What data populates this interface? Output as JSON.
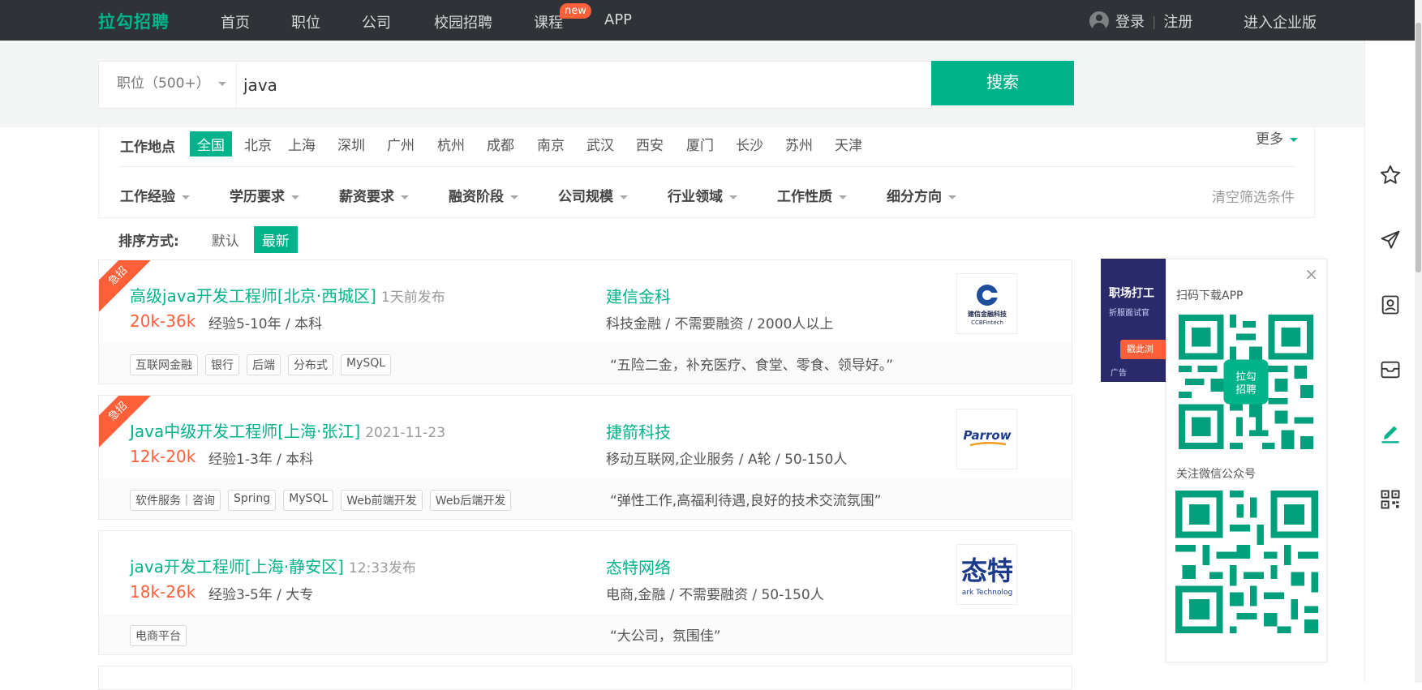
{
  "header": {
    "logo": "拉勾招聘",
    "nav": [
      "首页",
      "职位",
      "公司",
      "校园招聘",
      "课程",
      "APP"
    ],
    "new_badge": "new",
    "login": "登录",
    "register": "注册",
    "enterprise": "进入企业版"
  },
  "search": {
    "type_label": "职位（500+）",
    "query": "java",
    "button": "搜索"
  },
  "filters": {
    "location_label": "工作地点",
    "cities": [
      "全国",
      "北京",
      "上海",
      "深圳",
      "广州",
      "杭州",
      "成都",
      "南京",
      "武汉",
      "西安",
      "厦门",
      "长沙",
      "苏州",
      "天津"
    ],
    "active_city": "全国",
    "more": "更多",
    "dropdowns": [
      "工作经验",
      "学历要求",
      "薪资要求",
      "融资阶段",
      "公司规模",
      "行业领域",
      "工作性质",
      "细分方向"
    ],
    "clear": "清空筛选条件"
  },
  "sort": {
    "label": "排序方式:",
    "options": [
      "默认",
      "最新"
    ],
    "active": "最新"
  },
  "jobs": [
    {
      "urgent": "急招",
      "title": "高级java开发工程师[北京·西城区]",
      "published": "1天前发布",
      "salary": "20k-36k",
      "requirements": "经验5-10年 / 本科",
      "company": "建信金科",
      "company_info": "科技金融 / 不需要融资 / 2000人以上",
      "logo_text": "建信金融科技",
      "logo_subtext": "CCBFintech",
      "tags": [
        "互联网金融",
        "银行",
        "后端",
        "分布式",
        "MySQL"
      ],
      "slogan": "“五险二金，补充医疗、食堂、零食、领导好。”"
    },
    {
      "urgent": "急招",
      "title": "Java中级开发工程师[上海·张江]",
      "published": "2021-11-23",
      "salary": "12k-20k",
      "requirements": "经验1-3年 / 本科",
      "company": "捷箭科技",
      "company_info": "移动互联网,企业服务 / A轮 / 50-150人",
      "logo_text": "Parrow",
      "tags": [
        "软件服务｜咨询",
        "Spring",
        "MySQL",
        "Web前端开发",
        "Web后端开发"
      ],
      "slogan": "“弹性工作,高福利待遇,良好的技术交流氛围”"
    },
    {
      "urgent": "",
      "title": "java开发工程师[上海·静安区]",
      "published": "12:33发布",
      "salary": "18k-26k",
      "requirements": "经验3-5年 / 大专",
      "company": "态特网络",
      "company_info": "电商,金融 / 不需要融资 / 50-150人",
      "logo_text": "态特",
      "logo_subtext": "ark Technolog",
      "tags": [
        "电商平台"
      ],
      "slogan": "“大公司，氛围佳”"
    }
  ],
  "side_ad": {
    "title": "职场打工",
    "subtitle": "折服面试官",
    "button": "戳此浏",
    "ad_label": "广告"
  },
  "qr_panel": {
    "close": "×",
    "app_caption": "扫码下载APP",
    "app_center_label": "拉勾\n招聘",
    "wechat_caption": "关注微信公众号"
  },
  "rail_icons": [
    "star-icon",
    "send-icon",
    "resume-icon",
    "inbox-icon",
    "edit-icon",
    "qrcode-icon"
  ],
  "colors": {
    "brand": "#00b38a",
    "salary": "#fd5f39",
    "header_bg": "#2f3337"
  }
}
